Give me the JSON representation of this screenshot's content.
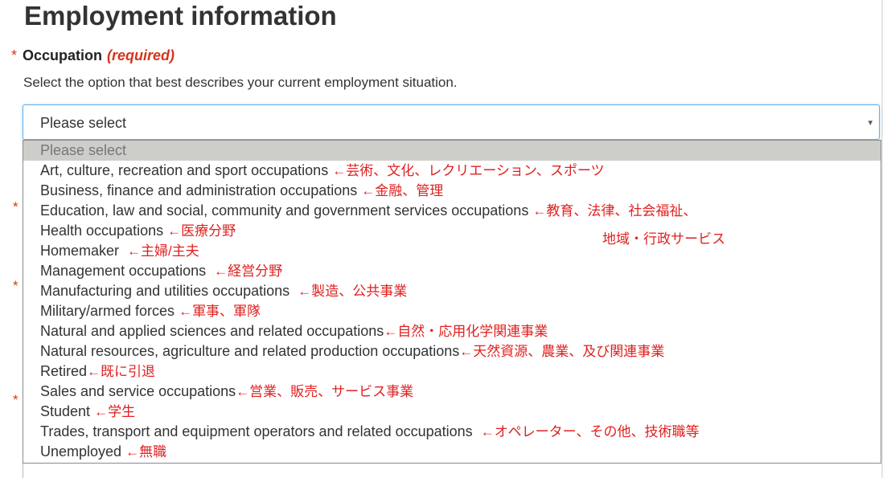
{
  "section": {
    "title": "Employment information"
  },
  "field": {
    "star": "*",
    "label": "Occupation",
    "required": "(required)",
    "hint": "Select the option that best describes your current employment situation."
  },
  "select": {
    "value": "Please select",
    "arrow": "▾"
  },
  "background_stars": [
    "*",
    "*",
    "*"
  ],
  "options": [
    {
      "label": "Please select",
      "note": "",
      "gap": ""
    },
    {
      "label": "Art, culture, recreation and sport occupations",
      "note": "←芸術、文化、レクリエーション、スポーツ",
      "gap": " "
    },
    {
      "label": "Business, finance and administration occupations",
      "note": "←金融、管理",
      "gap": " "
    },
    {
      "label": "Education, law and social, community and government services occupations",
      "note": "←教育、法律、社会福祉、",
      "gap": " "
    },
    {
      "label": "Health occupations",
      "note": "←医療分野",
      "gap": " "
    },
    {
      "label": "Homemaker",
      "note": "←主婦/主夫",
      "gap": " "
    },
    {
      "label": "Management occupations",
      "note": "←経営分野",
      "gap": " "
    },
    {
      "label": "Manufacturing and utilities occupations",
      "note": "←製造、公共事業",
      "gap": " "
    },
    {
      "label": "Military/armed forces",
      "note": "←軍事、軍隊",
      "gap": " "
    },
    {
      "label": "Natural and applied sciences and related occupations",
      "note": "←自然・応用化学関連事業",
      "gap": ""
    },
    {
      "label": "Natural resources, agriculture and related production occupations",
      "note": "←天然資源、農業、及び関連事業",
      "gap": ""
    },
    {
      "label": "Retired",
      "note": "←既に引退",
      "gap": ""
    },
    {
      "label": "Sales and service occupations",
      "note": "←営業、販売、サービス事業",
      "gap": ""
    },
    {
      "label": "Student",
      "note": "←学生",
      "gap": " "
    },
    {
      "label": "Trades, transport and equipment operators and related occupations",
      "note": "←オペレーター、その他、技術職等",
      "gap": " "
    },
    {
      "label": "Unemployed",
      "note": "←無職",
      "gap": " "
    }
  ],
  "extra_note": "地域・行政サービス",
  "colors": {
    "required": "#d4351c",
    "annotation": "#e02020",
    "selected_bg": "#cdcdc9",
    "focus_border": "#66afe9"
  }
}
